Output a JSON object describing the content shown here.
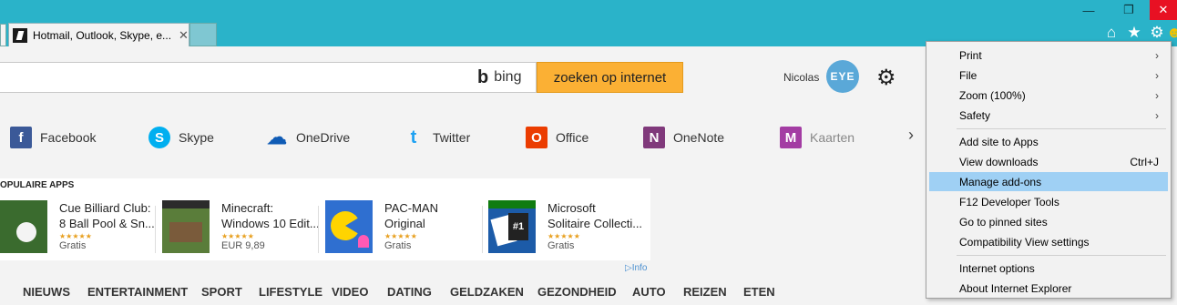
{
  "browser": {
    "tab_title": "Hotmail, Outlook, Skype, e...",
    "tab_close": "✕",
    "win_min": "—",
    "win_restore": "❐",
    "win_close": "✕",
    "toolbar_icons": [
      "home-icon",
      "favorites-star-icon",
      "tools-gear-icon",
      "feedback-smiley-icon"
    ]
  },
  "search": {
    "placeholder": "",
    "engine_label": "bing",
    "button_label": "zoeken op internet"
  },
  "user": {
    "name": "Nicolas",
    "avatar_text": "EYE"
  },
  "quick_links": [
    {
      "label": "Facebook",
      "icon": "f",
      "color": "#3b5998"
    },
    {
      "label": "Skype",
      "icon": "S",
      "color": "#00aff0"
    },
    {
      "label": "OneDrive",
      "icon": "☁",
      "color": "#0f5bb5"
    },
    {
      "label": "Twitter",
      "icon": "t",
      "color": "#1da1f2"
    },
    {
      "label": "Office",
      "icon": "O",
      "color": "#eb3c00"
    },
    {
      "label": "OneNote",
      "icon": "N",
      "color": "#80397b"
    },
    {
      "label": "Kaarten",
      "icon": "M",
      "color": "#a33ca3"
    }
  ],
  "apps": {
    "title": "OPULAIRE APPS",
    "info": "Info",
    "items": [
      {
        "line1": "Cue Billiard Club:",
        "line2": "8 Ball Pool & Sn...",
        "stars": "★★★★★",
        "price": "Gratis"
      },
      {
        "line1": "Minecraft:",
        "line2": "Windows 10 Edit...",
        "stars": "★★★★★",
        "price": "EUR 9,89"
      },
      {
        "line1": "PAC-MAN",
        "line2": "Original",
        "stars": "★★★★★",
        "price": "Gratis"
      },
      {
        "line1": "Microsoft",
        "line2": "Solitaire Collecti...",
        "stars": "★★★★★",
        "price": "Gratis"
      }
    ]
  },
  "nav": [
    "NIEUWS",
    "ENTERTAINMENT",
    "SPORT",
    "LIFESTYLE",
    "VIDEO",
    "DATING",
    "GELDZAKEN",
    "GEZONDHEID",
    "AUTO",
    "REIZEN",
    "ETEN"
  ],
  "tools_menu": {
    "items": [
      {
        "label": "Print",
        "submenu": true
      },
      {
        "label": "File",
        "submenu": true
      },
      {
        "label": "Zoom (100%)",
        "submenu": true
      },
      {
        "label": "Safety",
        "submenu": true
      },
      {
        "label": "Add site to Apps"
      },
      {
        "label": "View downloads",
        "shortcut": "Ctrl+J"
      },
      {
        "label": "Manage add-ons",
        "highlighted": true
      },
      {
        "label": "F12 Developer Tools"
      },
      {
        "label": "Go to pinned sites"
      },
      {
        "label": "Compatibility View settings"
      },
      {
        "label": "Internet options"
      },
      {
        "label": "About Internet Explorer"
      }
    ]
  },
  "colors": {
    "titlebar": "#2ab3c9",
    "search_button": "#fbb034",
    "menu_highlight": "#9fd0f4",
    "close_button": "#e81123"
  }
}
